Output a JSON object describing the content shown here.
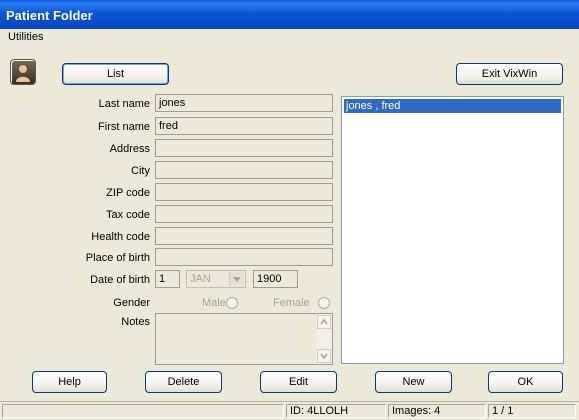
{
  "window": {
    "title": "Patient Folder"
  },
  "menu": {
    "items": [
      "Utilities"
    ]
  },
  "toolbar": {
    "list_label": "List",
    "exit_label": "Exit VixWin"
  },
  "form": {
    "last_name": {
      "label": "Last name",
      "value": "jones"
    },
    "first_name": {
      "label": "First name",
      "value": "fred"
    },
    "address": {
      "label": "Address",
      "value": ""
    },
    "city": {
      "label": "City",
      "value": ""
    },
    "zip": {
      "label": "ZIP code",
      "value": ""
    },
    "tax": {
      "label": "Tax code",
      "value": ""
    },
    "health": {
      "label": "Health code",
      "value": ""
    },
    "birthplace": {
      "label": "Place of birth",
      "value": ""
    },
    "dob": {
      "label": "Date of birth",
      "day": "1",
      "month": "JAN",
      "year": "1900"
    },
    "gender": {
      "label": "Gender",
      "male": "Male",
      "female": "Female"
    },
    "notes": {
      "label": "Notes",
      "value": ""
    }
  },
  "patient_list": {
    "items": [
      "jones , fred"
    ],
    "selected_index": 0
  },
  "actions": {
    "help": "Help",
    "delete": "Delete",
    "edit": "Edit",
    "new": "New",
    "ok": "OK"
  },
  "status": {
    "id": "ID: 4LLOLH",
    "images": "Images: 4",
    "page": "1 / 1"
  },
  "icons": {
    "avatar": "patient-avatar-icon",
    "combo": "chevron-down-icon",
    "scroll_up": "chevron-up-icon",
    "scroll_down": "chevron-down-icon"
  },
  "colors": {
    "title_bar": "#0a55d7",
    "selection": "#316ac5",
    "face": "#ece9d8"
  }
}
